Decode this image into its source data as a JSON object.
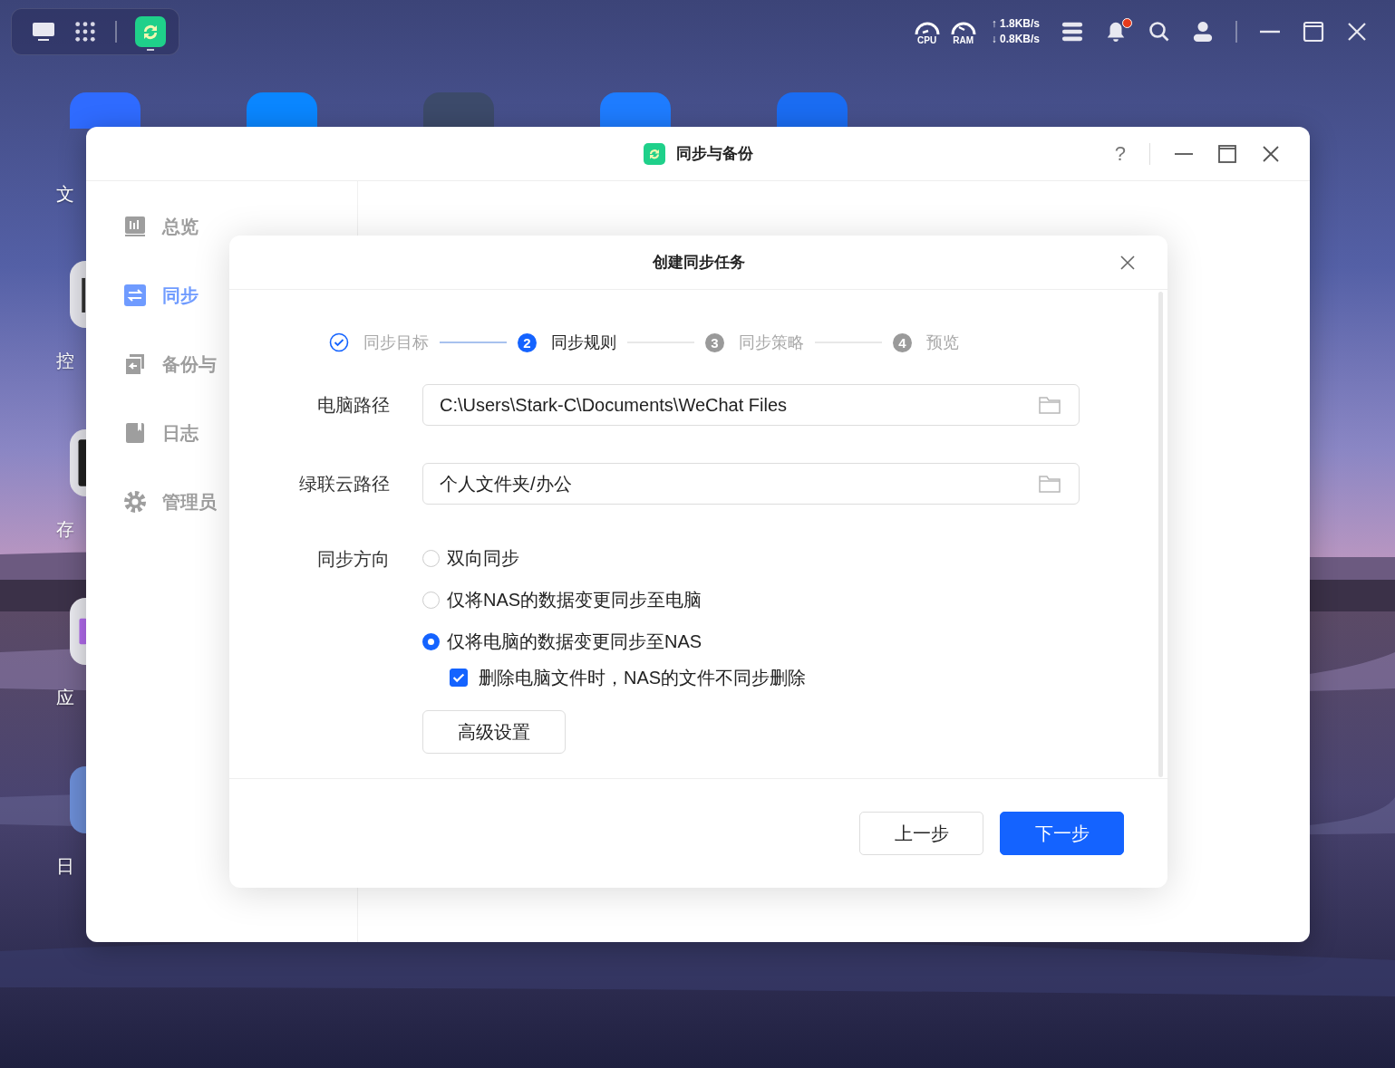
{
  "top_bar": {
    "cpu_label": "CPU",
    "ram_label": "RAM",
    "upload": "↑ 1.8KB/s",
    "download": "↓ 0.8KB/s",
    "notification_dot": true
  },
  "desktop_icons": [
    {
      "label": "文"
    },
    {
      "label": "控",
      "kind": "control"
    },
    {
      "label": "存",
      "kind": "storage"
    },
    {
      "label": "应",
      "kind": "apps"
    },
    {
      "label": "日",
      "kind": "calendar"
    }
  ],
  "window": {
    "title": "同步与备份",
    "help": "?"
  },
  "sidebar": {
    "items": [
      {
        "label": "总览",
        "kind": "overview",
        "selected": false
      },
      {
        "label": "同步",
        "kind": "sync",
        "selected": true
      },
      {
        "label": "备份与",
        "kind": "backup",
        "selected": false
      },
      {
        "label": "日志",
        "kind": "log",
        "selected": false
      },
      {
        "label": "管理员",
        "kind": "admin",
        "selected": false
      }
    ]
  },
  "dialog": {
    "title": "创建同步任务",
    "steps": [
      {
        "label": "同步目标",
        "done": true,
        "selected": false
      },
      {
        "number": "2",
        "label": "同步规则",
        "done": false,
        "selected": true
      },
      {
        "number": "3",
        "label": "同步策略",
        "done": false,
        "selected": false
      },
      {
        "number": "4",
        "label": "预览",
        "done": false,
        "selected": false
      }
    ],
    "fields": [
      {
        "label": "电脑路径",
        "value": "C:\\Users\\Stark-C\\Documents\\WeChat Files"
      },
      {
        "label": "绿联云路径",
        "value": "个人文件夹/办公"
      }
    ],
    "direction": {
      "label": "同步方向",
      "options": [
        {
          "label": "双向同步",
          "selected": false
        },
        {
          "label": "仅将NAS的数据变更同步至电脑",
          "selected": false
        },
        {
          "label": "仅将电脑的数据变更同步至NAS",
          "selected": true
        }
      ],
      "option": {
        "label": "删除电脑文件时，NAS的文件不同步删除",
        "checked": true
      }
    },
    "advanced_button": "高级设置",
    "buttons": [
      {
        "label": "上一步",
        "kind": "secondary"
      },
      {
        "label": "下一步",
        "kind": "primary"
      }
    ]
  }
}
